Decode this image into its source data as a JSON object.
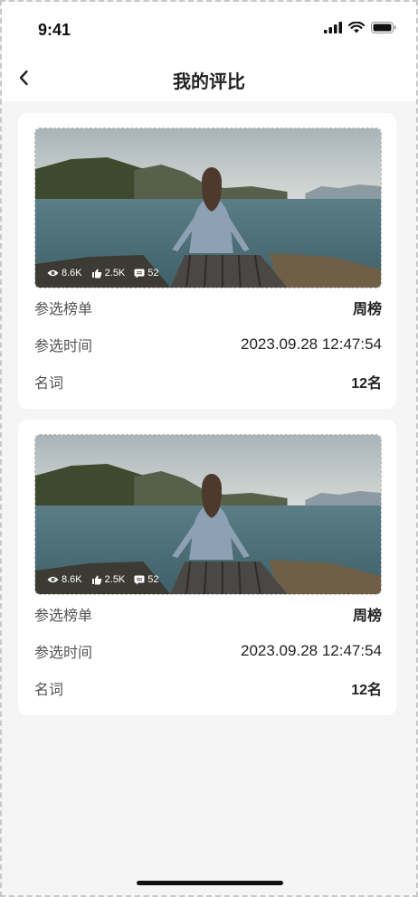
{
  "status_bar": {
    "time": "9:41",
    "icons": [
      "signal-icon",
      "wifi-icon",
      "battery-icon"
    ]
  },
  "header": {
    "title": "我的评比",
    "back_icon": "chevron-left-icon"
  },
  "entries": [
    {
      "image": "woman-sitting-on-pier-lake-photo",
      "stats": {
        "views": "8.6K",
        "likes": "2.5K",
        "comments": "52"
      },
      "list_label": "参选榜单",
      "list_value": "周榜",
      "time_label": "参选时间",
      "time_value": "2023.09.28 12:47:54",
      "rank_label": "名词",
      "rank_value": "12名"
    },
    {
      "image": "woman-sitting-on-pier-lake-photo",
      "stats": {
        "views": "8.6K",
        "likes": "2.5K",
        "comments": "52"
      },
      "list_label": "参选榜单",
      "list_value": "周榜",
      "time_label": "参选时间",
      "time_value": "2023.09.28 12:47:54",
      "rank_label": "名词",
      "rank_value": "12名"
    }
  ],
  "colors": {
    "page_background": "#f5f5f5",
    "card_background": "#ffffff",
    "text_primary": "#222222",
    "text_secondary": "#555555"
  }
}
